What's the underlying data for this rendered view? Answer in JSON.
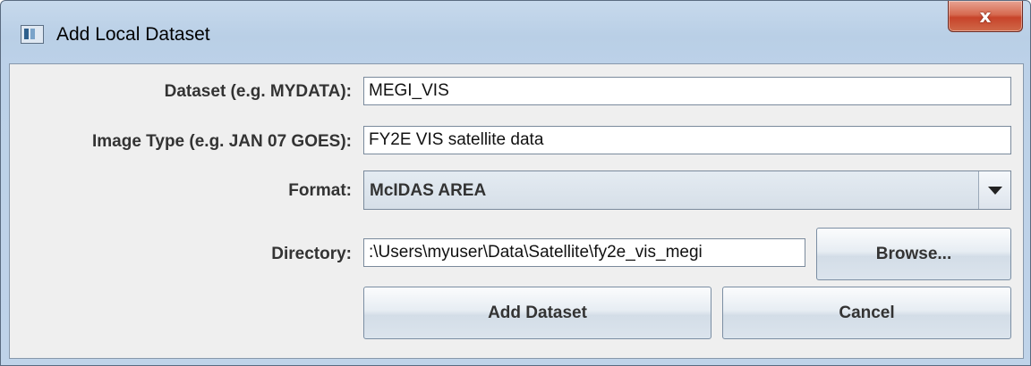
{
  "window": {
    "title": "Add Local Dataset",
    "close_label": "x"
  },
  "form": {
    "dataset_label": "Dataset (e.g. MYDATA):",
    "dataset_value": "MEGI_VIS",
    "image_type_label": "Image Type (e.g. JAN 07 GOES):",
    "image_type_value": "FY2E VIS satellite data",
    "format_label": "Format:",
    "format_value": "McIDAS AREA",
    "directory_label": "Directory:",
    "directory_value": ":\\Users\\myuser\\Data\\Satellite\\fy2e_vis_megi",
    "browse_label": "Browse..."
  },
  "actions": {
    "add_label": "Add Dataset",
    "cancel_label": "Cancel"
  },
  "icons": {
    "app": "window-app-icon",
    "close": "close-icon",
    "dropdown": "chevron-down-icon"
  }
}
